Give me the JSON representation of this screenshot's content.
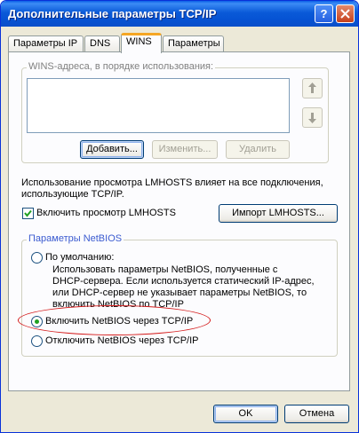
{
  "window": {
    "title": "Дополнительные параметры TCP/IP",
    "help_label": "?"
  },
  "tabs": [
    {
      "label": "Параметры IP",
      "active": false
    },
    {
      "label": "DNS",
      "active": false
    },
    {
      "label": "WINS",
      "active": true
    },
    {
      "label": "Параметры",
      "active": false
    }
  ],
  "wins": {
    "group_label": "WINS-адреса, в порядке использования:",
    "addresses": [],
    "add_label": "Добавить...",
    "edit_label": "Изменить...",
    "delete_label": "Удалить"
  },
  "lmhosts": {
    "info_line1": "Использование просмотра LMHOSTS влияет на все подключения,",
    "info_line2": "использующие TCP/IP.",
    "enable_label": "Включить просмотр LMHOSTS",
    "enable_checked": true,
    "import_label": "Импорт LMHOSTS..."
  },
  "netbios": {
    "group_label": "Параметры NetBIOS",
    "default_label": "По умолчанию:",
    "default_desc": [
      "Использовать параметры NetBIOS, полученные с",
      "DHCP-сервера. Если используется статический IP-адрес,",
      "или DHCP-сервер не указывает параметры NetBIOS, то",
      "включить NetBIOS по TCP/IP"
    ],
    "enable_label": "Включить NetBIOS через TCP/IP",
    "disable_label": "Отключить NetBIOS через TCP/IP",
    "selected": "enable"
  },
  "footer": {
    "ok_label": "OK",
    "cancel_label": "Отмена"
  },
  "colors": {
    "titlebar": "#0a5ad8",
    "annotation": "#d41a1a",
    "radio_dot": "#21a121"
  }
}
